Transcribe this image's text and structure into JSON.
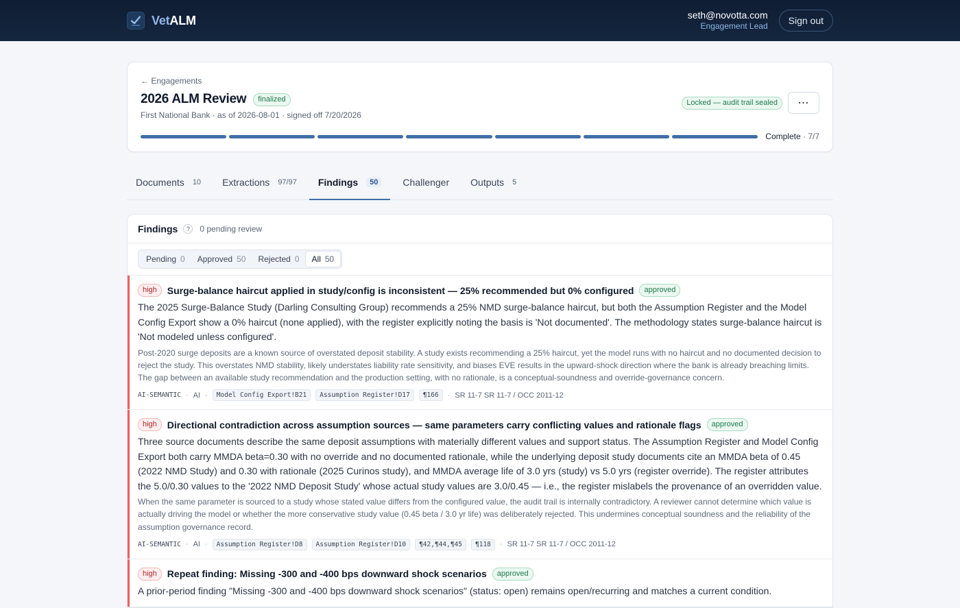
{
  "app": {
    "brand_prefix": "Vet",
    "brand_suffix": "ALM",
    "user_email": "seth@novotta.com",
    "user_role": "Engagement Lead",
    "signout_label": "Sign out"
  },
  "engagement": {
    "back_label": "← Engagements",
    "title": "2026 ALM Review",
    "status": "finalized",
    "subtitle": "First National Bank · as of 2026-08-01 · signed off 7/20/2026",
    "lock_label": "Locked — audit trail sealed",
    "more_label": "⋯",
    "progress_label": "Complete",
    "progress_count": "· 7/7",
    "progress_done": 7,
    "progress_total": 7
  },
  "tabs": [
    {
      "label": "Documents",
      "count": "10",
      "active": false
    },
    {
      "label": "Extractions",
      "count": "97/97",
      "active": false
    },
    {
      "label": "Findings",
      "count": "50",
      "active": true
    },
    {
      "label": "Challenger",
      "count": "",
      "active": false
    },
    {
      "label": "Outputs",
      "count": "5",
      "active": false
    }
  ],
  "findings_panel": {
    "title": "Findings",
    "help": "?",
    "pending_note": "0 pending review",
    "filters": [
      {
        "label": "Pending",
        "count": "0",
        "active": false
      },
      {
        "label": "Approved",
        "count": "50",
        "active": false
      },
      {
        "label": "Rejected",
        "count": "0",
        "active": false
      },
      {
        "label": "All",
        "count": "50",
        "active": true
      }
    ]
  },
  "findings": [
    {
      "severity": "high",
      "title": "Surge-balance haircut applied in study/config is inconsistent — 25% recommended but 0% configured",
      "status": "approved",
      "body": "The 2025 Surge-Balance Study (Darling Consulting Group) recommends a 25% NMD surge-balance haircut, but both the Assumption Register and the Model Config Export show a 0% haircut (none applied), with the register explicitly noting the basis is 'Not documented'. The methodology states surge-balance haircut is 'Not modeled unless configured'.",
      "note": "Post-2020 surge deposits are a known source of overstated deposit stability. A study exists recommending a 25% haircut, yet the model runs with no haircut and no documented decision to reject the study. This overstates NMD stability, likely understates liability rate sensitivity, and biases EVE results in the upward-shock direction where the bank is already breaching limits. The gap between an available study recommendation and the production setting, with no rationale, is a conceptual-soundness and override-governance concern.",
      "source": "AI-SEMANTIC",
      "origin": "AI",
      "refs": [
        "Model Config Export!B21",
        "Assumption Register!D17",
        "¶166"
      ],
      "regs": "SR 11-7 SR 11-7 / OCC 2011-12"
    },
    {
      "severity": "high",
      "title": "Directional contradiction across assumption sources — same parameters carry conflicting values and rationale flags",
      "status": "approved",
      "body": "Three source documents describe the same deposit assumptions with materially different values and support status. The Assumption Register and Model Config Export both carry MMDA beta=0.30 with no override and no documented rationale, while the underlying deposit study documents cite an MMDA beta of 0.45 (2022 NMD Study) and 0.30 with rationale (2025 Curinos study), and MMDA average life of 3.0 yrs (study) vs 5.0 yrs (register override). The register attributes the 5.0/0.30 values to the '2022 NMD Deposit Study' whose actual study values are 3.0/0.45 — i.e., the register mislabels the provenance of an overridden value.",
      "note": "When the same parameter is sourced to a study whose stated value differs from the configured value, the audit trail is internally contradictory. A reviewer cannot determine which value is actually driving the model or whether the more conservative study value (0.45 beta / 3.0 yr life) was deliberately rejected. This undermines conceptual soundness and the reliability of the assumption governance record.",
      "source": "AI-SEMANTIC",
      "origin": "AI",
      "refs": [
        "Assumption Register!D8",
        "Assumption Register!D10",
        "¶42,¶44,¶45",
        "¶118"
      ],
      "regs": "SR 11-7 SR 11-7 / OCC 2011-12"
    },
    {
      "severity": "high",
      "title": "Repeat finding: Missing -300 and -400 bps downward shock scenarios",
      "status": "approved",
      "body": "A prior-period finding \"Missing -300 and -400 bps downward shock scenarios\" (status: open) remains open/recurring and matches a current condition.",
      "note": "",
      "source": "",
      "origin": "",
      "refs": [],
      "regs": ""
    }
  ]
}
